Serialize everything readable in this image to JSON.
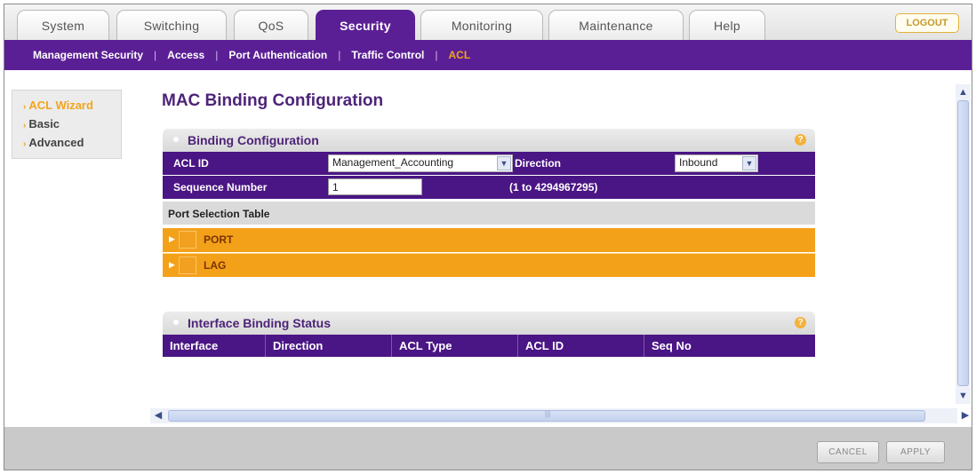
{
  "tabs": [
    {
      "label": "System",
      "active": false
    },
    {
      "label": "Switching",
      "active": false
    },
    {
      "label": "QoS",
      "active": false
    },
    {
      "label": "Security",
      "active": true
    },
    {
      "label": "Monitoring",
      "active": false
    },
    {
      "label": "Maintenance",
      "active": false
    },
    {
      "label": "Help",
      "active": false
    }
  ],
  "logout_label": "LOGOUT",
  "subnav": [
    {
      "label": "Management Security",
      "active": false
    },
    {
      "label": "Access",
      "active": false
    },
    {
      "label": "Port Authentication",
      "active": false
    },
    {
      "label": "Traffic Control",
      "active": false
    },
    {
      "label": "ACL",
      "active": true
    }
  ],
  "subnav_separator": "|",
  "left_menu": [
    {
      "label": "ACL Wizard",
      "active": true
    },
    {
      "label": "Basic",
      "active": false
    },
    {
      "label": "Advanced",
      "active": false
    }
  ],
  "page_title": "MAC Binding Configuration",
  "binding_config": {
    "title": "Binding Configuration",
    "acl_id_label": "ACL ID",
    "acl_id_value": "Management_Accounting",
    "direction_label": "Direction",
    "direction_value": "Inbound",
    "sequence_label": "Sequence Number",
    "sequence_value": "1",
    "sequence_range": "(1 to 4294967295)"
  },
  "port_selection": {
    "title": "Port Selection Table",
    "rows": [
      "PORT",
      "LAG"
    ]
  },
  "interface_status": {
    "title": "Interface Binding Status",
    "columns": [
      "Interface",
      "Direction",
      "ACL Type",
      "ACL ID",
      "Seq No"
    ]
  },
  "help_glyph": "?",
  "footer": {
    "cancel_label": "CANCEL",
    "apply_label": "APPLY"
  },
  "colors": {
    "brand_purple": "#5b1f95",
    "row_purple": "#4a1584",
    "accent_orange": "#f4a11a"
  }
}
